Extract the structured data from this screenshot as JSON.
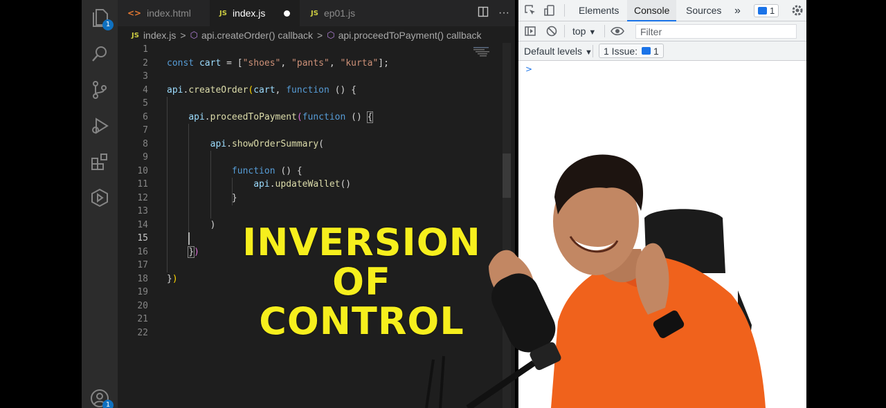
{
  "colors": {
    "editor_bg": "#1e1e1e",
    "activity_bar_bg": "#2c2c2c",
    "accent_badge": "#0e70c0",
    "keyword": "#569cd6",
    "variable": "#9cdcfe",
    "function": "#dcdcaa",
    "string": "#ce9178",
    "overlay_text": "#f6ef1d",
    "devtools_active_tab": "#1a73e8",
    "shirt_orange": "#f0621c"
  },
  "activity_bar": {
    "items": [
      {
        "icon": "files-icon",
        "badge": "1"
      },
      {
        "icon": "search-icon"
      },
      {
        "icon": "source-control-icon"
      },
      {
        "icon": "run-debug-icon"
      },
      {
        "icon": "extensions-icon"
      },
      {
        "icon": "remote-explorer-icon"
      }
    ],
    "account_badge": "1"
  },
  "tabs": [
    {
      "label": "index.html",
      "type": "html",
      "icon": "<>"
    },
    {
      "label": "index.js",
      "type": "js",
      "icon": "JS",
      "active": true,
      "dirty": true
    },
    {
      "label": "ep01.js",
      "type": "js",
      "icon": "JS"
    }
  ],
  "tab_actions": {
    "split_icon": "split-editor-icon",
    "more": "···"
  },
  "breadcrumb": {
    "file_tag": "JS",
    "file": "index.js",
    "sep": ">",
    "item1": "api.createOrder() callback",
    "item2": "api.proceedToPayment() callback"
  },
  "editor": {
    "line_numbers": [
      "1",
      "2",
      "3",
      "4",
      "5",
      "6",
      "7",
      "8",
      "9",
      "10",
      "11",
      "12",
      "13",
      "14",
      "15",
      "16",
      "17",
      "18",
      "19",
      "20",
      "21",
      "22"
    ],
    "current_line": 15,
    "code": {
      "l2": {
        "a": "const",
        "b": " ",
        "c": "cart",
        "d": " = [",
        "e": "\"shoes\"",
        "f": ", ",
        "g": "\"pants\"",
        "h": ", ",
        "i": "\"kurta\"",
        "j": "];"
      },
      "l4": {
        "a": "api",
        "b": ".",
        "c": "createOrder",
        "d": "(",
        "e": "cart",
        "f": ", ",
        "g": "function",
        "h": " () ",
        "i": "{"
      },
      "l6": {
        "indent": "    ",
        "a": "api",
        "b": ".",
        "c": "proceedToPayment",
        "d": "(",
        "e": "function",
        "f": " () ",
        "g": "{"
      },
      "l8": {
        "indent": "        ",
        "a": "api",
        "b": ".",
        "c": "showOrderSummary",
        "d": "("
      },
      "l10": {
        "indent": "            ",
        "a": "function",
        "b": " () ",
        "c": "{"
      },
      "l11": {
        "indent": "                ",
        "a": "api",
        "b": ".",
        "c": "updateWallet",
        "d": "()"
      },
      "l12": {
        "indent": "            ",
        "a": "}"
      },
      "l14": {
        "indent": "        ",
        "a": ")"
      },
      "l16": {
        "indent": "    ",
        "a": "}",
        "b": ")"
      },
      "l18": {
        "a": "}",
        "b": ")"
      }
    }
  },
  "devtools": {
    "tabs": [
      "Elements",
      "Console",
      "Sources"
    ],
    "active_tab": "Console",
    "overflow": "»",
    "message_count": "1",
    "context": "top",
    "filter_placeholder": "Filter",
    "levels": "Default levels",
    "issues_label": "1 Issue:",
    "issues_count": "1",
    "prompt": ">"
  },
  "overlay": {
    "line1": "INVERSION",
    "line2": "OF",
    "line3": "CONTROL"
  }
}
